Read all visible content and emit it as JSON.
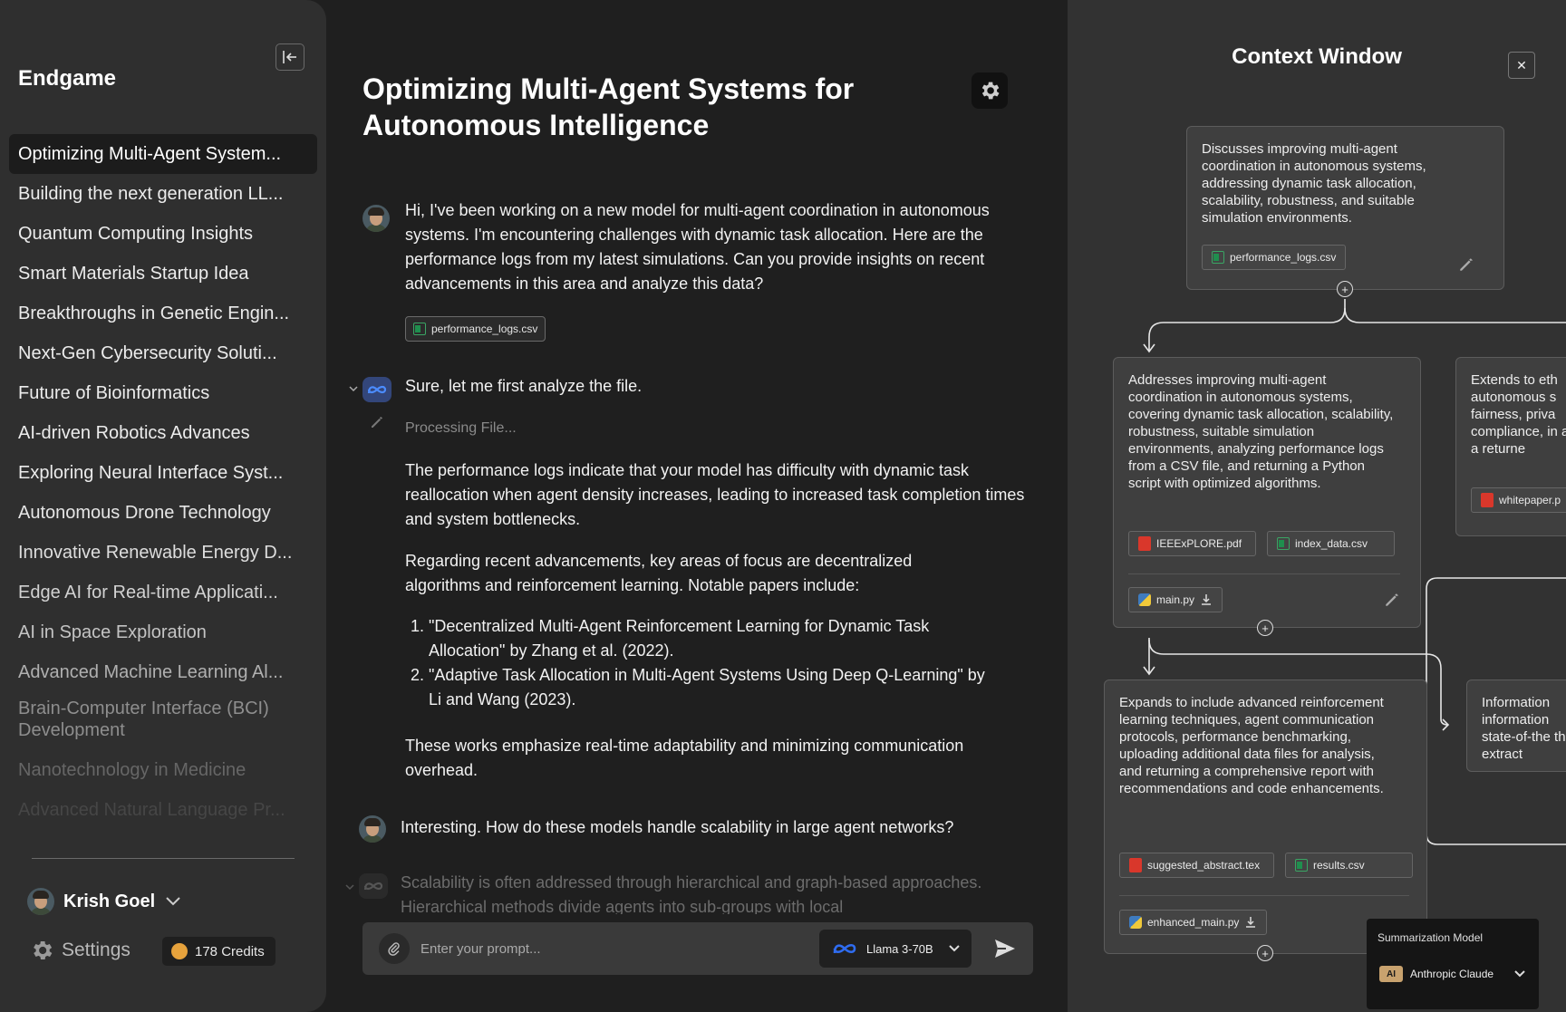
{
  "sidebar": {
    "app_title": "Endgame",
    "conversations": [
      {
        "label": "Optimizing Multi-Agent System...",
        "color": "#ffffff"
      },
      {
        "label": "Building the next generation LL...",
        "color": "#ececec"
      },
      {
        "label": "Quantum Computing Insights",
        "color": "#ececec"
      },
      {
        "label": "Smart Materials Startup Idea",
        "color": "#ececec"
      },
      {
        "label": "Breakthroughs in Genetic Engin...",
        "color": "#ececec"
      },
      {
        "label": "Next-Gen Cybersecurity Soluti...",
        "color": "#ececec"
      },
      {
        "label": "Future of Bioinformatics",
        "color": "#ececec"
      },
      {
        "label": "AI-driven Robotics Advances",
        "color": "#ececec"
      },
      {
        "label": "Exploring Neural Interface Syst...",
        "color": "#ececec"
      },
      {
        "label": "Autonomous Drone Technology",
        "color": "#e6e6e6"
      },
      {
        "label": "Innovative Renewable Energy D...",
        "color": "#dedede"
      },
      {
        "label": "Edge AI for Real-time Applicati...",
        "color": "#d2d2d2"
      },
      {
        "label": "AI in Space Exploration",
        "color": "#c4c4c4"
      },
      {
        "label": "Advanced Machine Learning Al...",
        "color": "#b0b0b0"
      },
      {
        "label": "Brain-Computer Interface (BCI) Development",
        "color": "#8e8e8e"
      },
      {
        "label": "Nanotechnology in Medicine",
        "color": "#666666"
      },
      {
        "label": "Advanced Natural Language Pr...",
        "color": "#464646"
      }
    ],
    "user_name": "Krish Goel",
    "settings_label": "Settings",
    "credits_label": "178 Credits"
  },
  "chat": {
    "title": "Optimizing Multi-Agent Systems for Autonomous Intelligence",
    "user_msg_1": "Hi, I've been working on a new model for multi-agent coordination in autonomous systems. I'm encountering challenges with dynamic task allocation. Here are the performance logs from my latest simulations. Can you provide insights on recent advancements in this area and analyze this data?",
    "user_attachment": "performance_logs.csv",
    "ai_intro": "Sure, let me first analyze the file.",
    "processing": "Processing File...",
    "ai_para_1": "The performance logs indicate that your model has difficulty with dynamic task reallocation when agent density increases, leading to increased task completion times and system bottlenecks.",
    "ai_para_2": "Regarding recent advancements, key areas of focus are decentralized algorithms and reinforcement learning. Notable papers include:",
    "references": [
      "\"Decentralized Multi-Agent Reinforcement Learning for Dynamic Task Allocation\" by Zhang et al. (2022).",
      "\"Adaptive Task Allocation in Multi-Agent Systems Using Deep Q-Learning\" by Li and Wang (2023)."
    ],
    "ai_para_3": "These works emphasize real-time adaptability and minimizing communication overhead.",
    "user_msg_2": "Interesting. How do these models handle scalability in large agent networks?",
    "ai_partial": "Scalability is often addressed through hierarchical and graph-based approaches. Hierarchical methods divide agents into sub-groups with local",
    "prompt_placeholder": "Enter your prompt...",
    "model_label": "Llama 3-70B"
  },
  "context": {
    "title": "Context Window",
    "close_label": "✕",
    "node_1": {
      "text": "Discusses improving multi-agent coordination in autonomous systems, addressing dynamic task allocation, scalability, robustness, and suitable simulation environments.",
      "file": "performance_logs.csv"
    },
    "node_2": {
      "text": "Addresses improving multi-agent coordination in autonomous systems, covering dynamic task allocation, scalability, robustness, suitable simulation environments, analyzing performance logs from a CSV file, and returning a Python script with optimized algorithms.",
      "files": [
        "IEEExPLORE.pdf",
        "index_data.csv"
      ],
      "output": "main.py"
    },
    "node_3": {
      "text": "Extends to eth autonomous s fairness, priva compliance, in and a returne",
      "file": "whitepaper.p"
    },
    "node_4": {
      "text": "Expands to include advanced reinforcement learning techniques, agent communication protocols, performance benchmarking, uploading additional data files for analysis, and returning a comprehensive report with recommendations and code enhancements.",
      "files": [
        "suggested_abstract.tex",
        "results.csv"
      ],
      "output": "enhanced_main.py"
    },
    "node_5": {
      "text": "Information information state-of-the their extract"
    },
    "summarization_label": "Summarization Model",
    "summarization_model": "Anthropic Claude",
    "anthropic_badge": "AI"
  },
  "icons": {
    "collapse": "collapse-sidebar-icon",
    "gear": "gear-icon",
    "meta": "meta-logo-icon",
    "paperclip": "paperclip-icon",
    "send": "send-icon",
    "pencil": "pencil-icon",
    "download": "download-icon",
    "chevron": "chevron-down-icon"
  },
  "colors": {
    "sidebar_bg": "#2f2f2f",
    "main_bg": "#1f1f1f",
    "context_bg": "#323232",
    "credits_coin": "#e6a23c",
    "meta_blue": "#2f6cf0"
  }
}
